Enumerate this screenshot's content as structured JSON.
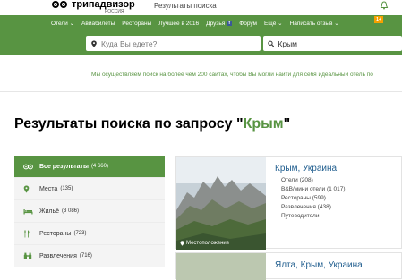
{
  "header": {
    "logo_text": "трипадвизор",
    "logo_sub": "РОССИЯ",
    "breadcrumb": "Результаты поиска"
  },
  "nav": {
    "items": [
      "Отели ⌄",
      "Авиабилеты",
      "Рестораны",
      "Лучшее в 2016",
      "Друзья",
      "Форум",
      "Ещё ⌄",
      "Написать отзыв ⌄"
    ],
    "badge": "1+"
  },
  "search": {
    "where_placeholder": "Куда Вы едете?",
    "query_value": "Крым"
  },
  "meta_text": "Мы осуществляем поиск на более чем 200 сайтах, чтобы Вы могли найти для себя идеальный отель по",
  "title": {
    "prefix": "Результаты поиска по запросу \"",
    "query": "Крым",
    "suffix": "\""
  },
  "sidebar": {
    "items": [
      {
        "label": "Все результаты",
        "count": "(4 660)",
        "icon": "owl-icon"
      },
      {
        "label": "Места",
        "count": "(135)",
        "icon": "map-pin-icon"
      },
      {
        "label": "Жильё",
        "count": "(3 086)",
        "icon": "bed-icon"
      },
      {
        "label": "Рестораны",
        "count": "(723)",
        "icon": "fork-knife-icon"
      },
      {
        "label": "Развлечения",
        "count": "(716)",
        "icon": "binoculars-icon"
      }
    ]
  },
  "results": [
    {
      "title": "Крым, Украина",
      "photo_tag": "Местоположение",
      "links": [
        "Отели (208)",
        "B&B/мини отели (1 017)",
        "Рестораны (599)",
        "Развлечения (438)",
        "Путеводители"
      ]
    },
    {
      "title": "Ялта, Крым, Украина"
    }
  ],
  "colors": {
    "brand_green": "#589442",
    "link_blue": "#1f5d8e"
  }
}
